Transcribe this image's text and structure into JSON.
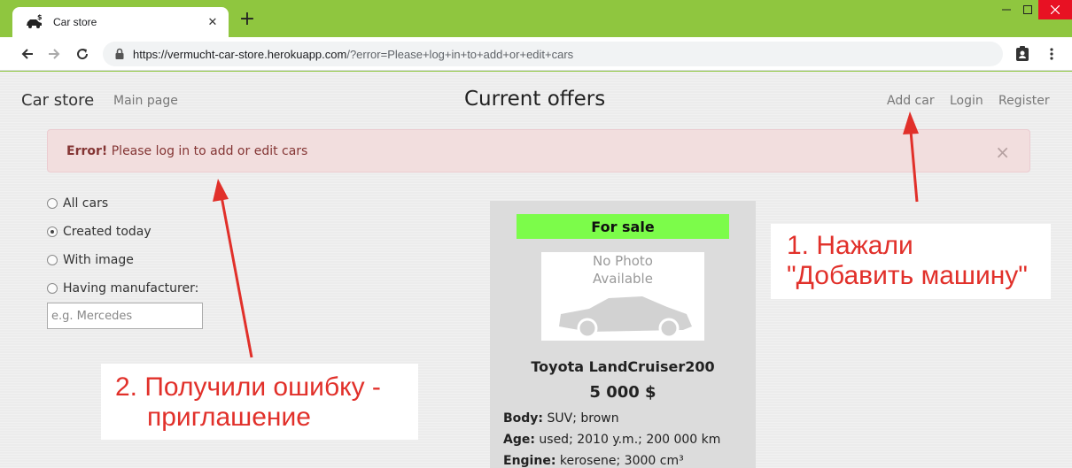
{
  "browser": {
    "tab_title": "Car store",
    "tab_close": "✕",
    "new_tab": "+",
    "url_host": "https://vermucht-car-store.herokuapp.com",
    "url_rest": "/?error=Please+log+in+to+add+or+edit+cars"
  },
  "navbar": {
    "brand": "Car store",
    "main_page": "Main page",
    "heading": "Current offers",
    "add_car": "Add car",
    "login": "Login",
    "register": "Register"
  },
  "alert": {
    "title": "Error!",
    "message": "Please log in to add or edit cars",
    "close": "×"
  },
  "filters": {
    "items": [
      {
        "label": "All cars",
        "checked": false
      },
      {
        "label": "Created today",
        "checked": true
      },
      {
        "label": "With image",
        "checked": false
      },
      {
        "label": "Having manufacturer:",
        "checked": false
      }
    ],
    "manufacturer_placeholder": "e.g. Mercedes"
  },
  "car": {
    "status": "For sale",
    "photo_line1": "No Photo",
    "photo_line2": "Available",
    "name": "Toyota LandCruiser200",
    "price": "5 000 $",
    "specs": [
      {
        "label": "Body:",
        "value": "SUV; brown"
      },
      {
        "label": "Age:",
        "value": "used; 2010 y.m.; 200 000 km"
      },
      {
        "label": "Engine:",
        "value": "kerosene; 3000 cm³"
      }
    ]
  },
  "annotations": {
    "note1_line1": "1. Нажали",
    "note1_line2": "\"Добавить машину\"",
    "note2_line1": "2. Получили ошибку -",
    "note2_line2": "приглашение"
  },
  "colors": {
    "chrome": "#8fc63f",
    "alert_bg": "#f2dede",
    "sale_badge": "#7cfc4a",
    "annotation": "#e1302a"
  }
}
